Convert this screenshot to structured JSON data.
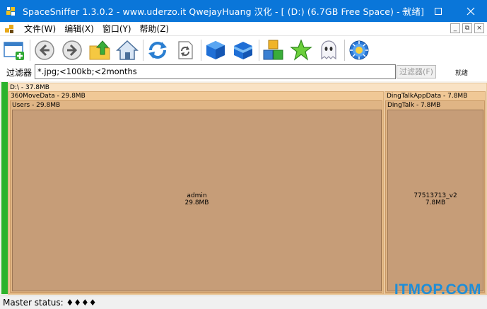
{
  "window": {
    "title": "SpaceSniffer 1.3.0.2 - www.uderzo.it  QwejayHuang 汉化 - [ (D:) (6.7GB Free Space) - 就绪]",
    "minimize_glyph": "—",
    "maximize_glyph": "☐",
    "close_glyph": "✕"
  },
  "menu": {
    "items": [
      "文件(W)",
      "编辑(X)",
      "窗口(Y)",
      "帮助(Z)"
    ],
    "mdi_buttons": [
      "_",
      "⧉",
      "×"
    ]
  },
  "toolbar": {
    "buttons": [
      "new-window-icon",
      "back-icon",
      "forward-icon",
      "up-folder-icon",
      "home-icon",
      "refresh-icon",
      "rescan-icon",
      "blue-box-icon",
      "blue-box-open-icon",
      "colored-blocks-icon",
      "star-icon",
      "ghost-icon",
      "settings-gear-icon"
    ]
  },
  "filter": {
    "label": "过滤器",
    "value": "*.jpg;<100kb;<2months",
    "button": "过滤器(F)",
    "status": "就绪"
  },
  "treemap": {
    "root": "D:\\ - 37.8MB",
    "left_folder": "360MoveData - 29.8MB",
    "users": "Users - 29.8MB",
    "admin_name": "admin",
    "admin_size": "29.8MB",
    "right_folder": "DingTalkAppData - 7.8MB",
    "dingtalk": "DingTalk - 7.8MB",
    "file_name": "77513713_v2",
    "file_size": "7.8MB"
  },
  "status": {
    "text": "Master status: ♦♦♦♦"
  },
  "watermark": "ITMOP.COM",
  "colors": {
    "titlebar": "#0a76d9",
    "greenbar": "#2cb32c",
    "watermark": "#1e8ed8"
  }
}
